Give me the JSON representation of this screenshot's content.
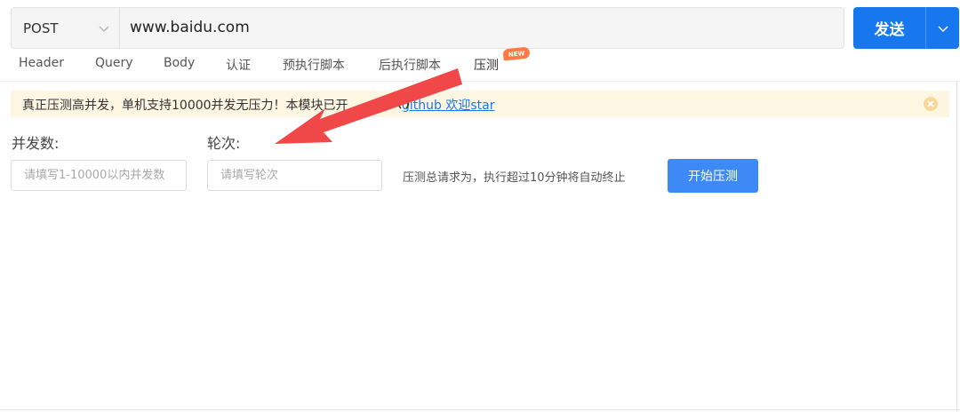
{
  "request": {
    "method": "POST",
    "url": "www.baidu.com",
    "send_label": "发送"
  },
  "tabs": [
    {
      "label": "Header",
      "active": false
    },
    {
      "label": "Query",
      "active": false
    },
    {
      "label": "Body",
      "active": false
    },
    {
      "label": "认证",
      "active": false
    },
    {
      "label": "预执行脚本",
      "active": false
    },
    {
      "label": "后执行脚本",
      "active": false
    },
    {
      "label": "压测",
      "active": true
    }
  ],
  "new_badge": "NEW",
  "alert": {
    "text": "真正压测高并发，单机支持10000并发无压力！本模块已开",
    "link_text": "github 欢迎star"
  },
  "form": {
    "concurrency_label": "并发数:",
    "concurrency_placeholder": "请填写1-10000以内并发数",
    "rounds_label": "轮次:",
    "rounds_placeholder": "请填写轮次",
    "hint": "压测总请求为，执行超过10分钟将自动终止",
    "start_label": "开始压测"
  },
  "colors": {
    "primary": "#1677ee",
    "alert_bg": "#fdf6e3",
    "annotation_arrow": "#f04848",
    "badge": "#ff7a45"
  }
}
